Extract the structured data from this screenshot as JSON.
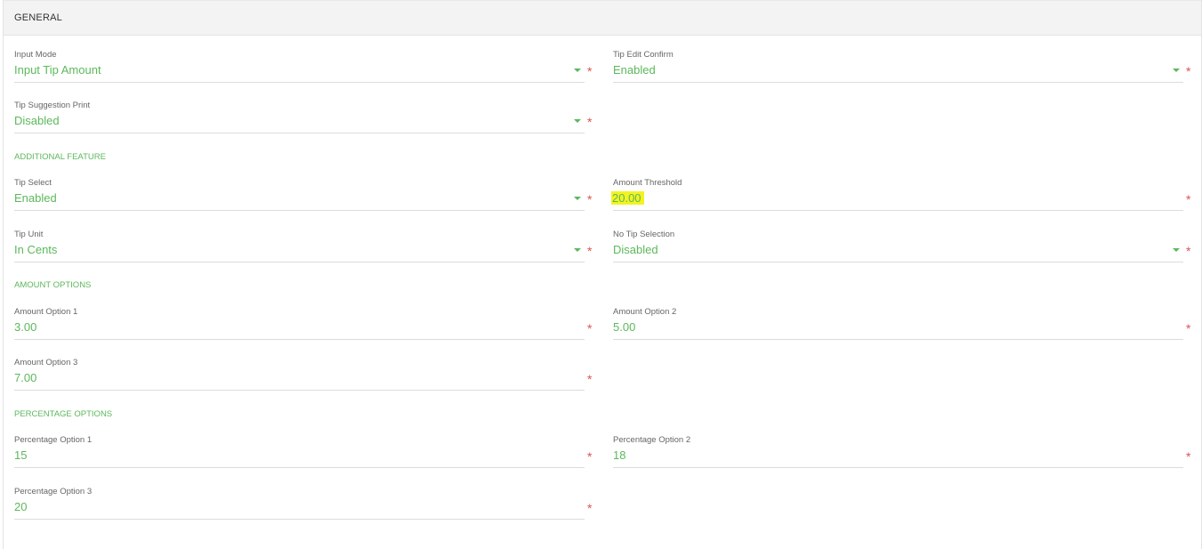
{
  "header": {
    "title": "GENERAL"
  },
  "general": {
    "input_mode": {
      "label": "Input Mode",
      "value": "Input Tip Amount",
      "required": "*"
    },
    "tip_edit_confirm": {
      "label": "Tip Edit Confirm",
      "value": "Enabled",
      "required": "*"
    },
    "tip_suggestion_print": {
      "label": "Tip Suggestion Print",
      "value": "Disabled",
      "required": "*"
    }
  },
  "additional_feature": {
    "title": "ADDITIONAL FEATURE",
    "tip_select": {
      "label": "Tip Select",
      "value": "Enabled",
      "required": "*"
    },
    "amount_threshold": {
      "label": "Amount Threshold",
      "value": "20.00",
      "required": "*"
    },
    "tip_unit": {
      "label": "Tip Unit",
      "value": "In Cents",
      "required": "*"
    },
    "no_tip_selection": {
      "label": "No Tip Selection",
      "value": "Disabled",
      "required": "*"
    }
  },
  "amount_options": {
    "title": "AMOUNT OPTIONS",
    "option1": {
      "label": "Amount Option 1",
      "value": "3.00",
      "required": "*"
    },
    "option2": {
      "label": "Amount Option 2",
      "value": "5.00",
      "required": "*"
    },
    "option3": {
      "label": "Amount Option 3",
      "value": "7.00",
      "required": "*"
    }
  },
  "percentage_options": {
    "title": "PERCENTAGE OPTIONS",
    "option1": {
      "label": "Percentage Option 1",
      "value": "15",
      "required": "*"
    },
    "option2": {
      "label": "Percentage Option 2",
      "value": "18",
      "required": "*"
    },
    "option3": {
      "label": "Percentage Option 3",
      "value": "20",
      "required": "*"
    }
  },
  "colors": {
    "accent": "#5cb85c",
    "required": "#e05252",
    "highlight": "#f3f322",
    "header_bg": "#f3f3f3"
  },
  "icons": {
    "select_caret": "chevron-down-icon",
    "required_marker": "asterisk-icon"
  }
}
